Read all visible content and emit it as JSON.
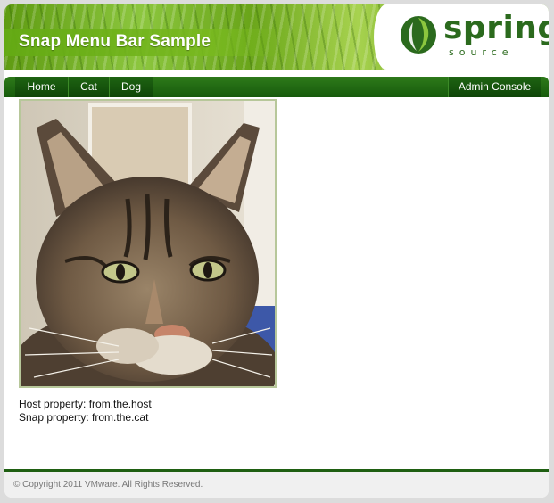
{
  "header": {
    "title": "Snap Menu Bar Sample",
    "logo": {
      "word": "spring",
      "sub": "source",
      "icon": "spring-leaf-icon"
    }
  },
  "nav": {
    "items": [
      {
        "label": "Home"
      },
      {
        "label": "Cat"
      },
      {
        "label": "Dog"
      }
    ],
    "admin_label": "Admin Console"
  },
  "content": {
    "image_subject": "cat-photo",
    "host_property_label": "Host property: from.the.host",
    "snap_property_label": "Snap property: from.the.cat"
  },
  "footer": {
    "copyright": "© Copyright 2011 VMware. All Rights Reserved."
  },
  "colors": {
    "brand_green": "#2b6a1d",
    "nav_dark": "#175a0c",
    "banner_light": "#8cc63e"
  }
}
